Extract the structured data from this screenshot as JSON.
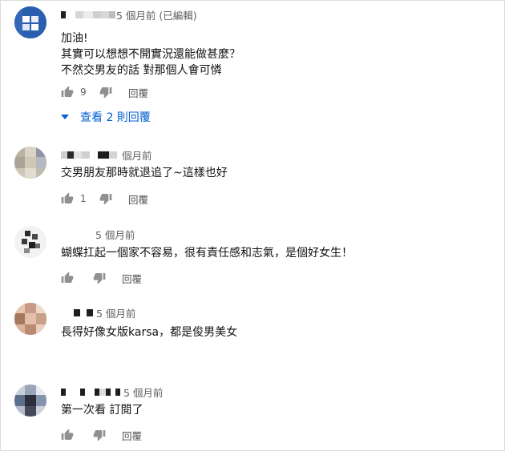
{
  "comments": [
    {
      "time": "5 個月前 (已編輯)",
      "lines": [
        "加油!",
        "其實可以想想不開實況還能做甚麼？",
        "不然交男友的話 對那個人會可憐"
      ],
      "likes": "9",
      "reply_label": "回覆",
      "view_replies": "查看 2 則回覆",
      "avatar_colors": [
        "#2a5fb0",
        "#ffffff",
        "#3a6ec0"
      ]
    },
    {
      "time": "個月前",
      "lines": [
        "交男朋友那時就退追了~這樣也好"
      ],
      "likes": "1",
      "reply_label": "回覆",
      "avatar_colors": [
        "#b8b3a3",
        "#d0c7b4",
        "#8e95a6",
        "#c9c2b0"
      ]
    },
    {
      "time": "5 個月前",
      "lines": [
        "蝴蝶扛起一個家不容易，很有責任感和志氣，是個好女生！"
      ],
      "likes": "",
      "reply_label": "回覆",
      "avatar_colors": [
        "#2b2b2b",
        "#e6e6e6",
        "#4a4a4a",
        "#f2f2f2"
      ]
    },
    {
      "time": "5 個月前",
      "lines": [
        "長得好像女版karsa，都是俊男美女"
      ],
      "likes": "",
      "reply_label": "回覆",
      "avatar_colors": [
        "#c79a86",
        "#e7c7b2",
        "#a6785f",
        "#ddb9a3"
      ]
    },
    {
      "time": "5 個月前",
      "lines": [
        "第一次看 訂閱了"
      ],
      "likes": "",
      "reply_label": "回覆",
      "avatar_colors": [
        "#5d6f8f",
        "#c9cfd9",
        "#2e2e3a",
        "#9aa6b8"
      ]
    }
  ]
}
